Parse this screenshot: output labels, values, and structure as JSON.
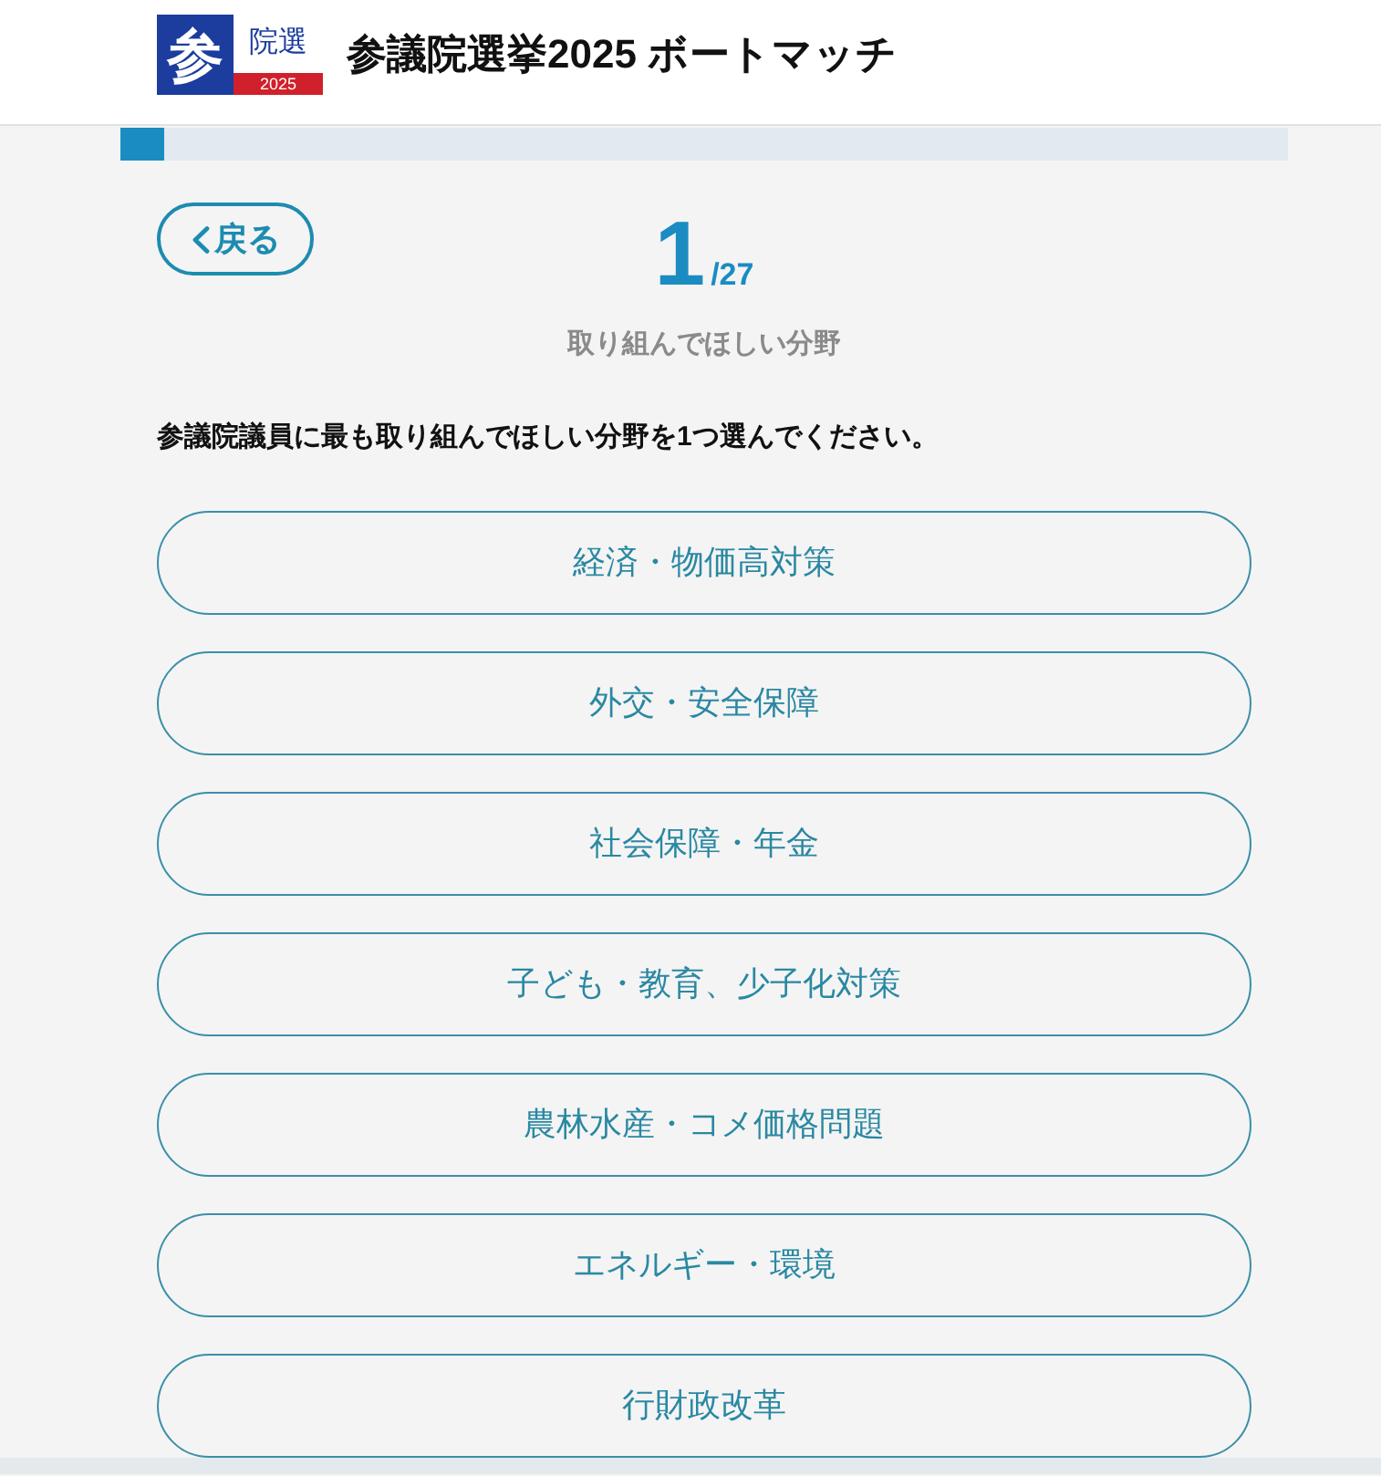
{
  "header": {
    "logo": {
      "main": "参",
      "side": "院選",
      "year": "2025"
    },
    "title": "参議院選挙2025 ボートマッチ"
  },
  "progress": {
    "level": 0.037
  },
  "back_button": {
    "label": "戻る"
  },
  "counter": {
    "current": "1",
    "total": "/27"
  },
  "category": "取り組んでほしい分野",
  "question": "参議院議員に最も取り組んでほしい分野を1つ選んでください。",
  "options": [
    {
      "label": "経済・物価高対策",
      "selected": false
    },
    {
      "label": "外交・安全保障",
      "selected": false
    },
    {
      "label": "社会保障・年金",
      "selected": false
    },
    {
      "label": "子ども・教育、少子化対策",
      "selected": false
    },
    {
      "label": "農林水産・コメ価格問題",
      "selected": false
    },
    {
      "label": "エネルギー・環境",
      "selected": false
    },
    {
      "label": "行財政改革",
      "selected": false
    }
  ]
}
